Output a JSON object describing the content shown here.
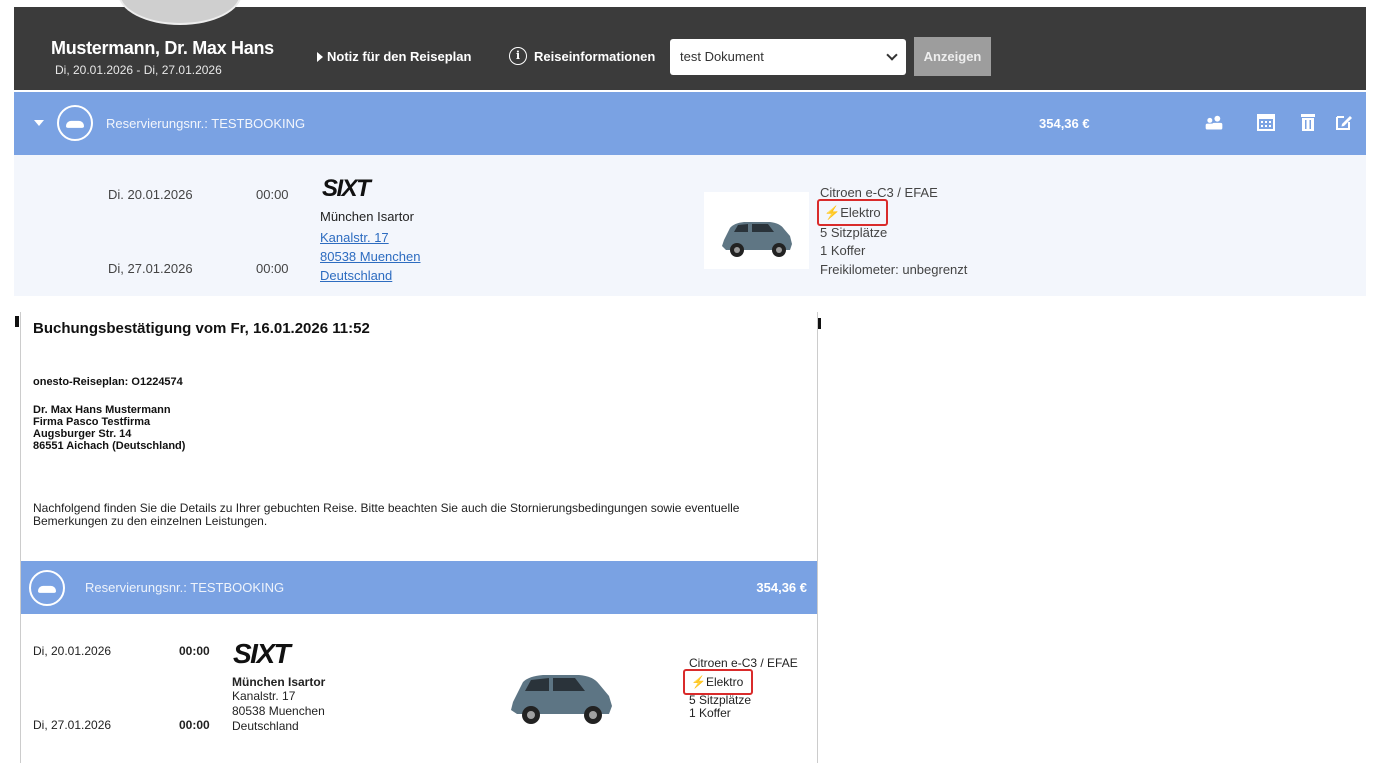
{
  "header": {
    "traveler_name": "Mustermann, Dr. Max Hans",
    "travel_dates": "Di, 20.01.2026 - Di, 27.01.2026",
    "note_link": "Notiz für den Reiseplan",
    "info_link": "Reiseinformationen",
    "info_icon": "i",
    "document_select": {
      "value": "test Dokument"
    },
    "show_button": "Anzeigen"
  },
  "booking": {
    "reservation_label": "Reservierungsnr.: TESTBOOKING",
    "price": "354,36 €",
    "actions": [
      "group-icon",
      "calendar-icon",
      "trash-icon",
      "edit-icon"
    ],
    "pickup": {
      "date": "Di. 20.01.2026",
      "time": "00:00"
    },
    "return": {
      "date": "Di, 27.01.2026",
      "time": "00:00"
    },
    "vendor_logo": "SIXT",
    "station": {
      "name": "München Isartor",
      "street": "Kanalstr. 17",
      "city": "80538 Muenchen",
      "country": "Deutschland"
    },
    "car": {
      "model": "Citroen e-C3 / EFAE",
      "fuel": "Elektro",
      "seats": "5 Sitzplätze",
      "luggage": "1 Koffer",
      "mileage": "Freikilometer: unbegrenzt"
    }
  },
  "email": {
    "title": "Buchungsbestätigung vom Fr, 16.01.2026 11:52",
    "plan_id": "onesto-Reiseplan: O1224574",
    "address": {
      "line1": "Dr. Max Hans Mustermann",
      "line2": "Firma Pasco Testfirma",
      "line3": "Augsburger Str. 14",
      "line4": "86551 Aichach (Deutschland)"
    },
    "intro": "Nachfolgend finden Sie die Details zu Ihrer gebuchten Reise. Bitte beachten Sie auch die Stornierungsbedingungen sowie eventuelle Bemerkungen zu den einzelnen Leistungen.",
    "reservation_label": "Reservierungsnr.: TESTBOOKING",
    "price": "354,36 €",
    "pickup": {
      "date": "Di, 20.01.2026",
      "time": "00:00"
    },
    "return": {
      "date": "Di, 27.01.2026",
      "time": "00:00"
    },
    "vendor_logo": "SIXT",
    "station": {
      "name": "München Isartor",
      "street": "Kanalstr. 17",
      "city": "80538 Muenchen",
      "country": "Deutschland"
    },
    "car": {
      "model": "Citroen e-C3 / EFAE",
      "fuel": "Elektro",
      "seats": "5 Sitzplätze",
      "luggage": "1 Koffer"
    }
  },
  "colors": {
    "header_bg": "#3b3b3b",
    "booking_bar": "#7aa2e3",
    "detail_bg": "#f3f6fc",
    "link": "#2d6cc0",
    "highlight": "#d92b2b"
  }
}
